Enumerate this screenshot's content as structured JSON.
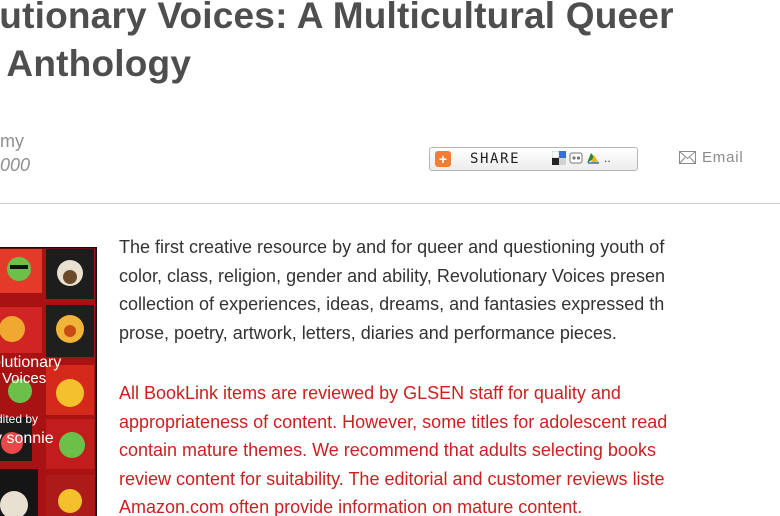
{
  "book": {
    "title_line1": "olutionary Voices: A Multicultural Queer",
    "title_line2": "th Anthology",
    "author": "my",
    "year": "000"
  },
  "share": {
    "label": "SHARE",
    "icons": [
      "addthis-plus-icon",
      "delicious-icon",
      "digg-icon",
      "favorites-icon"
    ],
    "more": "..",
    "accent": "#f37d35"
  },
  "email": {
    "label": "Email",
    "icon": "envelope-icon"
  },
  "cover": {
    "title_line1": "olutionary",
    "title_line2": "Voices",
    "editor_line1": "dited by",
    "editor_line2": "y sonnie",
    "background": "#b01414"
  },
  "description": {
    "lines": [
      "The first creative resource by and for queer and questioning youth of",
      "color, class, religion, gender and ability, Revolutionary Voices presen",
      "collection of experiences, ideas, dreams, and fantasies expressed th",
      "prose, poetry, artwork, letters, diaries and performance pieces."
    ]
  },
  "disclaimer": {
    "color": "#cc1f1f",
    "lines": [
      "All BookLink items are reviewed by GLSEN staff for quality and",
      "appropriateness of content. However, some titles for adolescent read",
      "contain mature themes. We recommend that adults selecting books",
      "review content for suitability. The editorial and customer reviews liste",
      "Amazon.com often provide information on mature content."
    ]
  }
}
